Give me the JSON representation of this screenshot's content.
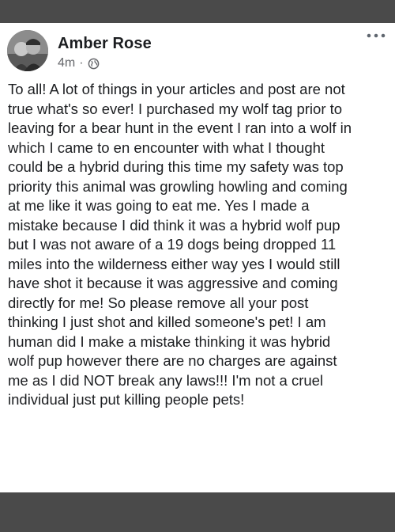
{
  "post": {
    "author": "Amber Rose",
    "time": "4m",
    "separator": "·",
    "privacy_icon": "globe-icon",
    "more_icon": "more-options-icon",
    "body": "To all! A lot of things in your articles and post are not\ntrue what's so ever! I purchased my wolf tag prior to\nleaving for a bear hunt in the event I ran into a wolf in\nwhich I came to en encounter with what I thought\ncould be a hybrid during this time my safety was top\npriority this animal was growling howling and coming\nat me like it was going to eat me. Yes I made a\nmistake because I did think it was a hybrid wolf pup\nbut I was not aware of a 19 dogs being dropped 11\nmiles into the wilderness either way yes I would still\nhave shot it  because it was aggressive and coming\ndirectly for me! So please remove all your post\nthinking I just shot and killed someone's pet! I am\nhuman did I make a mistake thinking it was hybrid\nwolf pup however there are no charges are against\nme as I did NOT break any laws!!! I'm not a cruel\nindividual just put killing people pets!"
  },
  "colors": {
    "frame": "#4a4a4a",
    "background": "#ffffff",
    "text": "#1c1e21",
    "secondary_text": "#65676b"
  }
}
